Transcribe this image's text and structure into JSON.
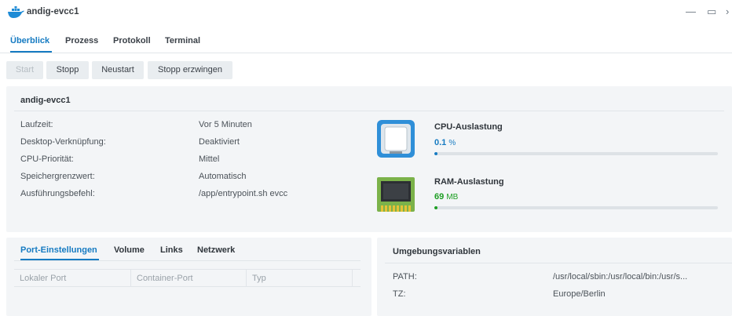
{
  "window": {
    "title": "andig-evcc1",
    "minimize": "—",
    "maximize": "▭",
    "close": "›"
  },
  "tabs": [
    "Überblick",
    "Prozess",
    "Protokoll",
    "Terminal"
  ],
  "toolbar": {
    "start": "Start",
    "stop": "Stopp",
    "restart": "Neustart",
    "force_stop": "Stopp erzwingen"
  },
  "overview": {
    "title": "andig-evcc1",
    "rows": [
      {
        "label": "Laufzeit:",
        "value": "Vor 5 Minuten"
      },
      {
        "label": "Desktop-Verknüpfung:",
        "value": "Deaktiviert"
      },
      {
        "label": "CPU-Priorität:",
        "value": "Mittel"
      },
      {
        "label": "Speichergrenzwert:",
        "value": "Automatisch"
      },
      {
        "label": "Ausführungsbefehl:",
        "value": "/app/entrypoint.sh evcc"
      }
    ]
  },
  "resources": {
    "cpu": {
      "title": "CPU-Auslastung",
      "value": "0.1",
      "unit": "%",
      "level": 0.001,
      "color": "#167bc2"
    },
    "ram": {
      "title": "RAM-Auslastung",
      "value": "69",
      "unit": "MB",
      "level": 0.005,
      "color": "#1c9e22"
    }
  },
  "ports": {
    "tabs": [
      "Port-Einstellungen",
      "Volume",
      "Links",
      "Netzwerk"
    ],
    "columns": [
      "Lokaler Port",
      "Container-Port",
      "Typ"
    ]
  },
  "environment": {
    "title": "Umgebungsvariablen",
    "vars": [
      {
        "key": "PATH:",
        "value": "/usr/local/sbin:/usr/local/bin:/usr/s..."
      },
      {
        "key": "TZ:",
        "value": "Europe/Berlin"
      }
    ]
  },
  "colors": {
    "accent": "#167bc2",
    "ram_green": "#1c9e22"
  }
}
